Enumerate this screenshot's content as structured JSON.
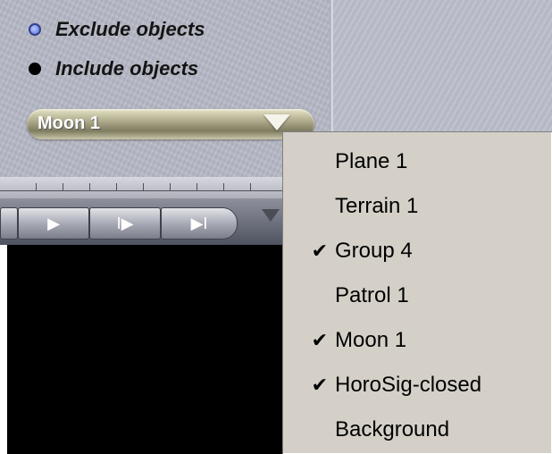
{
  "filter_options": [
    {
      "label": "Exclude objects",
      "selected": false
    },
    {
      "label": "Include objects",
      "selected": true
    }
  ],
  "object_dropdown": {
    "value": "Moon 1"
  },
  "transport": {
    "buttons": [
      {
        "icon": "play-icon",
        "glyph": "▶"
      },
      {
        "icon": "step-forward-icon",
        "glyph": "I▶"
      },
      {
        "icon": "skip-to-end-icon",
        "glyph": "▶I"
      }
    ]
  },
  "menu": {
    "items": [
      {
        "label": "Plane 1",
        "checked": false
      },
      {
        "label": "Terrain 1",
        "checked": false
      },
      {
        "label": "Group 4",
        "checked": true
      },
      {
        "label": "Patrol 1",
        "checked": false
      },
      {
        "label": "Moon 1",
        "checked": true
      },
      {
        "label": "HoroSig-closed",
        "checked": true
      },
      {
        "label": "Background",
        "checked": false
      }
    ],
    "check_glyph": "✔"
  },
  "colors": {
    "panel": "#b6b9c6",
    "radio_selected_outline": "#32418c",
    "menu_background": "#d4d0c8"
  }
}
